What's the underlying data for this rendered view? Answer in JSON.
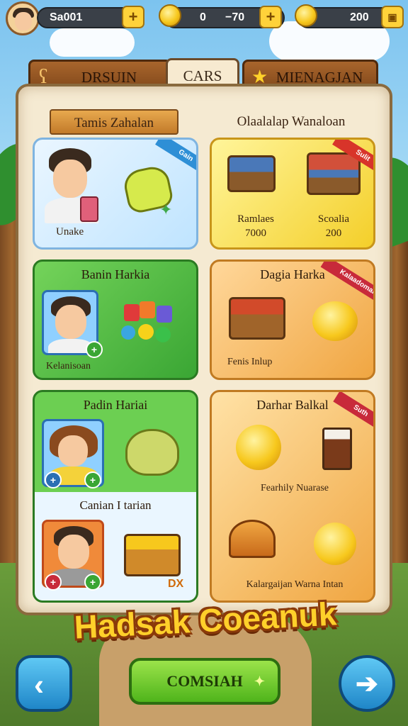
{
  "top_bar": {
    "player_name": "Sa001",
    "currency_1_value": "0",
    "currency_1_rate": "−70",
    "currency_2_value": "200",
    "plus_label": "+"
  },
  "tabs": [
    {
      "label": "DRSUIN"
    },
    {
      "label": "CARS"
    },
    {
      "label": "MIENAGJAN"
    }
  ],
  "headers": {
    "left": "Tamis Zahalan",
    "right": "Olaalalap Wanaloan"
  },
  "cards": {
    "c1": {
      "caption": "Unake",
      "tag": "Gain"
    },
    "c2": {
      "tag": "Sulit",
      "item1_name": "Ramlaes",
      "item1_price": "7000",
      "item2_name": "Scoalia",
      "item2_price": "200"
    },
    "c3": {
      "title": "Banin Harkia",
      "caption": "Kelanisoan"
    },
    "c4": {
      "title": "Dagia Harka",
      "caption": "Fenis Inlup",
      "tag": "Kalaadomal"
    },
    "c5": {
      "title": "Padin Hariai",
      "subtitle": "Canian I tarian",
      "badge": "DX"
    },
    "c6": {
      "title": "Darhar Balkal",
      "tag": "Suth",
      "line1": "Fearhily Nuarase",
      "line2": "Kalargaijan Warna Intan"
    }
  },
  "banner": "Hadsak Coeanuk",
  "footer": {
    "back_icon": "chevron-left-icon",
    "next_icon": "arrow-right-icon",
    "main_button": "COMSIAH"
  }
}
